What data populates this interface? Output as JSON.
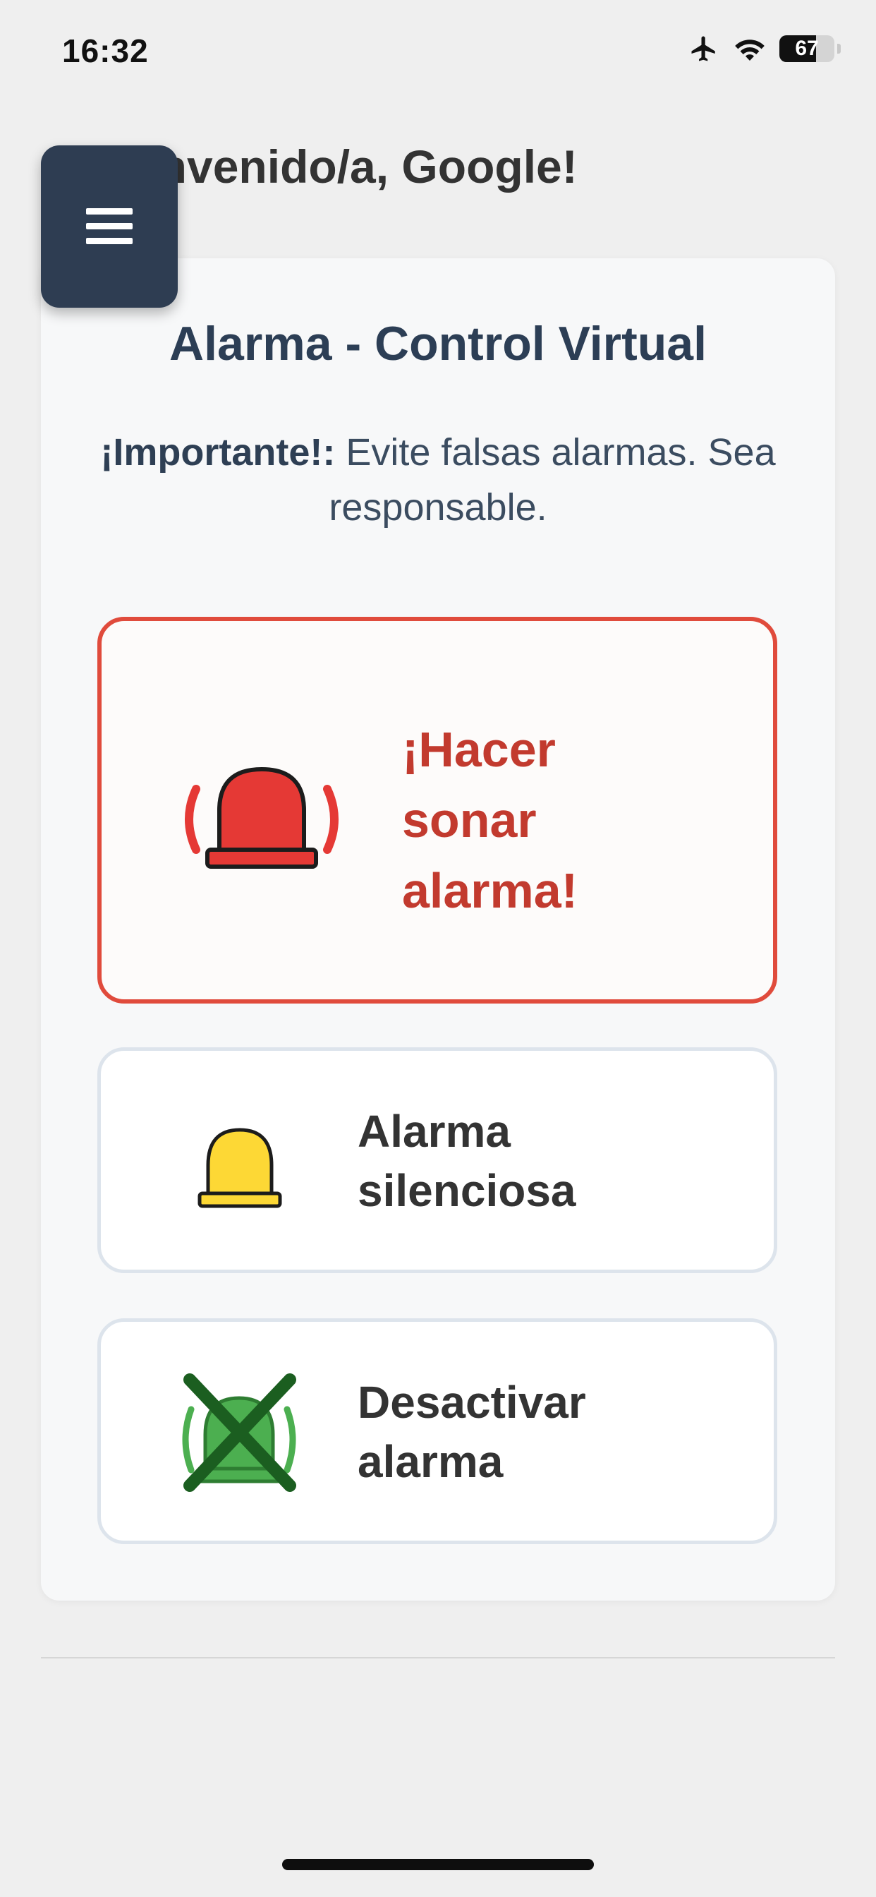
{
  "status_bar": {
    "time": "16:32",
    "battery_level": "67",
    "battery_fraction": 0.67,
    "icons": [
      "airplane-mode-icon",
      "wifi-icon",
      "battery-icon"
    ]
  },
  "header": {
    "greeting": "¡Bienvenido/a, Google!",
    "menu_icon": "hamburger-menu-icon"
  },
  "card": {
    "title": "Alarma - Control Virtual",
    "notice_strong": "¡Importante!:",
    "notice_text": " Evite falsas alarmas. Sea responsable."
  },
  "actions": {
    "sound_alarm": {
      "label": "¡Hacer sonar alarma!",
      "icon": "red-siren-icon"
    },
    "silent_alarm": {
      "label": "Alarma silenciosa",
      "icon": "yellow-siren-icon"
    },
    "deactivate_alarm": {
      "label": "Desactivar alarma",
      "icon": "green-siren-crossed-icon"
    }
  },
  "colors": {
    "page_background": "#efefef",
    "card_background": "#f7f8f9",
    "menu_button": "#2e3d52",
    "title_text": "#2c3e55",
    "alarm_accent": "#e04b3c",
    "alarm_text": "#c23a2e",
    "siren_red": "#e53935",
    "siren_yellow": "#fdd835",
    "siren_green": "#4caf50",
    "cross_dark_green": "#1b5e20",
    "neutral_border": "#dde4ec"
  }
}
